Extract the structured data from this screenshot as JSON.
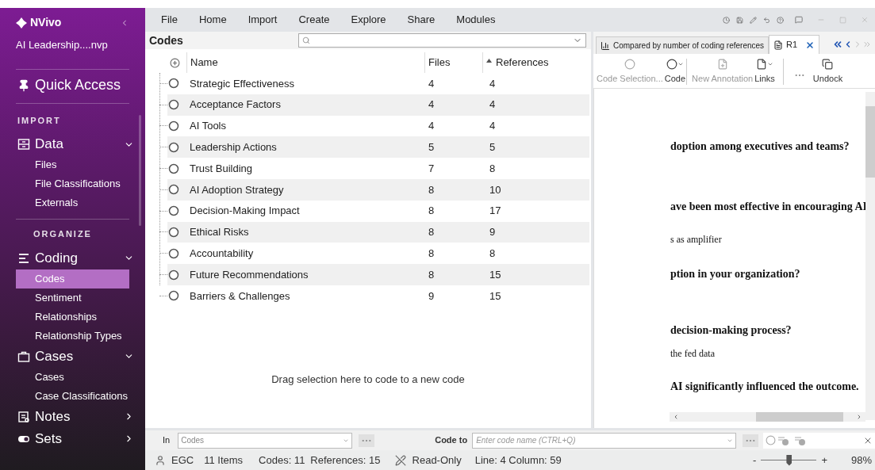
{
  "app": {
    "name": "NVivo",
    "project": "AI Leadership....nvp"
  },
  "sidebar": [
    {
      "kind": "link",
      "label": "Quick Access"
    },
    {
      "kind": "header",
      "label": "IMPORT"
    },
    {
      "kind": "group",
      "label": "Data",
      "expanded": true,
      "children": [
        {
          "label": "Files",
          "selected": false
        },
        {
          "label": "File Classifications",
          "selected": false
        },
        {
          "label": "Externals",
          "selected": false
        }
      ]
    },
    {
      "kind": "header",
      "label": "ORGANIZE"
    },
    {
      "kind": "group",
      "label": "Coding",
      "expanded": true,
      "children": [
        {
          "label": "Codes",
          "selected": true
        },
        {
          "label": "Sentiment",
          "selected": false
        },
        {
          "label": "Relationships",
          "selected": false
        },
        {
          "label": "Relationship Types",
          "selected": false
        }
      ]
    },
    {
      "kind": "group",
      "label": "Cases",
      "expanded": true,
      "children": [
        {
          "label": "Cases",
          "selected": false
        },
        {
          "label": "Case Classifications",
          "selected": false
        }
      ]
    },
    {
      "kind": "group",
      "label": "Notes",
      "expanded": false
    },
    {
      "kind": "group",
      "label": "Sets",
      "expanded": false
    }
  ],
  "menu": [
    "File",
    "Home",
    "Import",
    "Create",
    "Explore",
    "Share",
    "Modules"
  ],
  "codes_pane": {
    "title": "Codes",
    "columns": [
      {
        "label": "Name",
        "sorted": false
      },
      {
        "label": "Files",
        "sorted": false
      },
      {
        "label": "References",
        "sorted": true
      }
    ],
    "rows": [
      {
        "name": "Strategic Effectiveness",
        "files": "4",
        "references": "4"
      },
      {
        "name": "Acceptance Factors",
        "files": "4",
        "references": "4"
      },
      {
        "name": "AI Tools",
        "files": "4",
        "references": "4"
      },
      {
        "name": "Leadership Actions",
        "files": "5",
        "references": "5"
      },
      {
        "name": "Trust Building",
        "files": "7",
        "references": "8"
      },
      {
        "name": "AI Adoption Strategy",
        "files": "8",
        "references": "10"
      },
      {
        "name": "Decision-Making Impact",
        "files": "8",
        "references": "17"
      },
      {
        "name": "Ethical Risks",
        "files": "8",
        "references": "9"
      },
      {
        "name": "Accountability",
        "files": "8",
        "references": "8"
      },
      {
        "name": "Future Recommendations",
        "files": "8",
        "references": "15"
      },
      {
        "name": "Barriers & Challenges",
        "files": "9",
        "references": "15"
      }
    ],
    "drop_hint": "Drag selection here to code to a new code"
  },
  "detail_pane": {
    "tabs": [
      {
        "label": "Compared by number of coding references",
        "kind": "chart",
        "selected": false
      },
      {
        "label": "R1",
        "kind": "document",
        "selected": true
      }
    ],
    "toolbar": [
      {
        "label": "Code Selection...",
        "disabled": true
      },
      {
        "label": "Code",
        "disabled": false
      },
      {
        "label": "New Annotation",
        "disabled": true
      },
      {
        "label": "Links",
        "disabled": false
      },
      {
        "label": "Undock",
        "disabled": false
      }
    ],
    "document": [
      {
        "text": "doption among executives and teams?",
        "kind": "question"
      },
      {
        "text": "ave been most effective in encouraging AI",
        "kind": "question"
      },
      {
        "text": "s as amplifier",
        "kind": "answer"
      },
      {
        "text": "ption in your organization?",
        "kind": "question"
      },
      {
        "text": "decision-making process?",
        "kind": "question"
      },
      {
        "text": "the fed data",
        "kind": "answer"
      },
      {
        "text": "AI significantly influenced the outcome.",
        "kind": "question"
      }
    ]
  },
  "coding_bar": {
    "in_label": "In",
    "in_value": "Codes",
    "code_to_label": "Code to",
    "code_to_placeholder": "Enter code name (CTRL+Q)"
  },
  "status_bar": {
    "user": "EGC",
    "items": "11 Items",
    "codes": "Codes: 11",
    "references": "References: 15",
    "mode": "Read-Only",
    "position": "Line: 4 Column: 59",
    "zoom": {
      "level": 0.5,
      "reading": "98%",
      "minus": "-",
      "plus": "+"
    }
  }
}
